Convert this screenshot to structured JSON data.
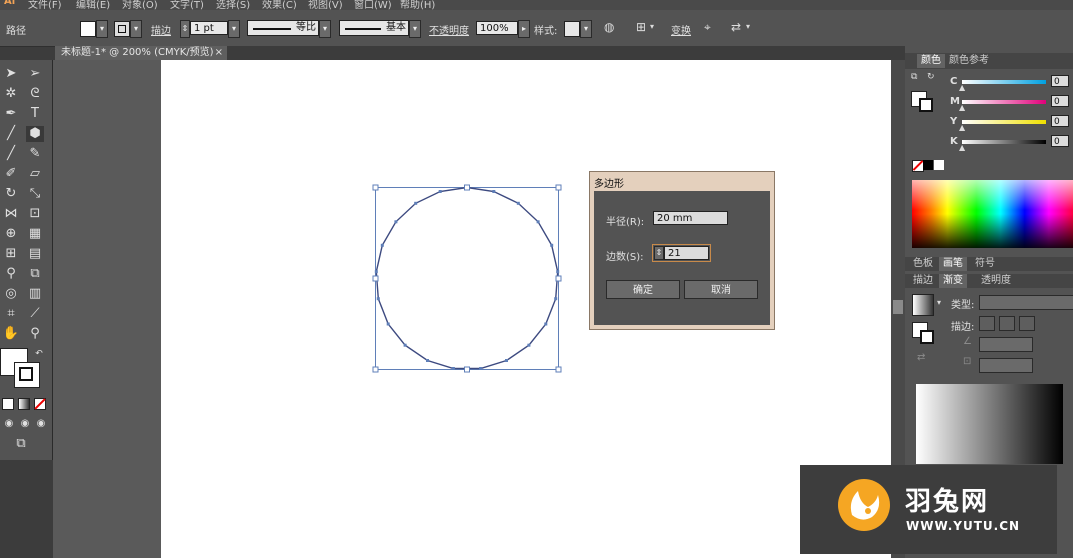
{
  "menubar": {
    "items": [
      "Ai",
      "文件(F)",
      "编辑(E)",
      "对象(O)",
      "文字(T)",
      "选择(S)",
      "效果(C)",
      "视图(V)",
      "窗口(W)",
      "帮助(H)"
    ]
  },
  "controlbar": {
    "selection_label": "路径",
    "stroke_label": "描边",
    "stroke_weight": "1 pt",
    "stroke_profile": "等比",
    "brush": "基本",
    "opacity_label": "不透明度",
    "opacity_value": "100%",
    "style_label": "样式:",
    "transform_label": "变换",
    "accent_color": "#f2a356"
  },
  "document": {
    "tab_title": "未标题-1* @ 200% (CMYK/预览)",
    "close_glyph": "×"
  },
  "dialog": {
    "title": "多边形",
    "radius_label": "半径(R):",
    "radius_value": "20 mm",
    "sides_label": "边数(S):",
    "sides_value": "21",
    "ok_label": "确定",
    "cancel_label": "取消"
  },
  "color_panel": {
    "tabs": [
      "颜色",
      "颜色参考"
    ],
    "channels": [
      {
        "label": "C",
        "value": "0",
        "color": "#00a0e0"
      },
      {
        "label": "M",
        "value": "0",
        "color": "#e0007a"
      },
      {
        "label": "Y",
        "value": "0",
        "color": "#f0e000"
      },
      {
        "label": "K",
        "value": "0",
        "color": "#000000"
      }
    ]
  },
  "swatch_panel": {
    "tabs": [
      "色板",
      "画笔",
      "符号"
    ]
  },
  "gradient_panel": {
    "tabs": [
      "描边",
      "渐变",
      "透明度"
    ],
    "type_label": "类型:",
    "stroke_label": "描边:"
  },
  "watermark": {
    "name": "羽兔网",
    "url": "WWW.YUTU.CN",
    "color": "#f5a623"
  }
}
